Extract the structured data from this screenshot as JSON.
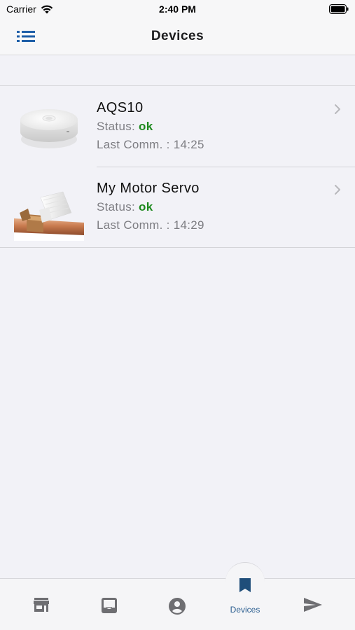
{
  "status_bar": {
    "carrier": "Carrier",
    "time": "2:40 PM"
  },
  "nav": {
    "title": "Devices",
    "menu_icon": "list-menu-icon"
  },
  "devices": [
    {
      "name": "AQS10",
      "status_label": "Status: ",
      "status_value": "ok",
      "last_comm": "Last Comm. : 14:25",
      "image": "air-quality-sensor"
    },
    {
      "name": "My Motor Servo",
      "status_label": "Status: ",
      "status_value": "ok",
      "last_comm": "Last Comm. : 14:29",
      "image": "motor-servo-valve"
    }
  ],
  "tabs": [
    {
      "icon": "store-icon",
      "label": ""
    },
    {
      "icon": "inbox-icon",
      "label": ""
    },
    {
      "icon": "account-circle-icon",
      "label": ""
    },
    {
      "icon": "bookmark-icon",
      "label": "Devices",
      "active": true
    },
    {
      "icon": "send-icon",
      "label": ""
    }
  ],
  "colors": {
    "accent": "#2a5d8f",
    "status_ok": "#1e8a1e",
    "background": "#f2f2f7"
  }
}
